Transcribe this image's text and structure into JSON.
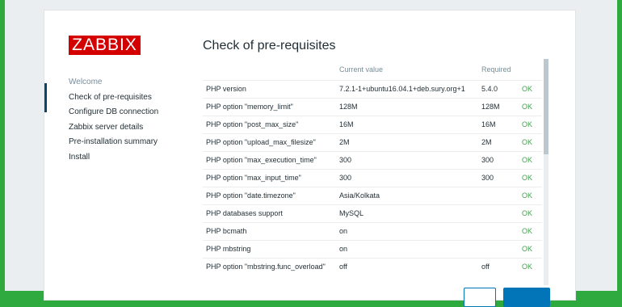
{
  "app": {
    "logo_text": "ZABBIX"
  },
  "sidebar": {
    "items": [
      {
        "label": "Welcome",
        "state": "done"
      },
      {
        "label": "Check of pre-requisites",
        "state": "current"
      },
      {
        "label": "Configure DB connection",
        "state": "pending"
      },
      {
        "label": "Zabbix server details",
        "state": "pending"
      },
      {
        "label": "Pre-installation summary",
        "state": "pending"
      },
      {
        "label": "Install",
        "state": "pending"
      }
    ]
  },
  "main": {
    "title": "Check of pre-requisites",
    "columns": {
      "name": "",
      "current": "Current value",
      "required": "Required",
      "status": ""
    },
    "rows": [
      {
        "name": "PHP version",
        "current": "7.2.1-1+ubuntu16.04.1+deb.sury.org+1",
        "required": "5.4.0",
        "status": "OK"
      },
      {
        "name": "PHP option \"memory_limit\"",
        "current": "128M",
        "required": "128M",
        "status": "OK"
      },
      {
        "name": "PHP option \"post_max_size\"",
        "current": "16M",
        "required": "16M",
        "status": "OK"
      },
      {
        "name": "PHP option \"upload_max_filesize\"",
        "current": "2M",
        "required": "2M",
        "status": "OK"
      },
      {
        "name": "PHP option \"max_execution_time\"",
        "current": "300",
        "required": "300",
        "status": "OK"
      },
      {
        "name": "PHP option \"max_input_time\"",
        "current": "300",
        "required": "300",
        "status": "OK"
      },
      {
        "name": "PHP option \"date.timezone\"",
        "current": "Asia/Kolkata",
        "required": "",
        "status": "OK"
      },
      {
        "name": "PHP databases support",
        "current": "MySQL",
        "required": "",
        "status": "OK"
      },
      {
        "name": "PHP bcmath",
        "current": "on",
        "required": "",
        "status": "OK"
      },
      {
        "name": "PHP mbstring",
        "current": "on",
        "required": "",
        "status": "OK"
      },
      {
        "name": "PHP option \"mbstring.func_overload\"",
        "current": "off",
        "required": "off",
        "status": "OK"
      }
    ]
  },
  "colors": {
    "brand": "#d40000",
    "ok": "#3fa54b",
    "accent": "#0275b8",
    "background": "#2faa3e"
  }
}
